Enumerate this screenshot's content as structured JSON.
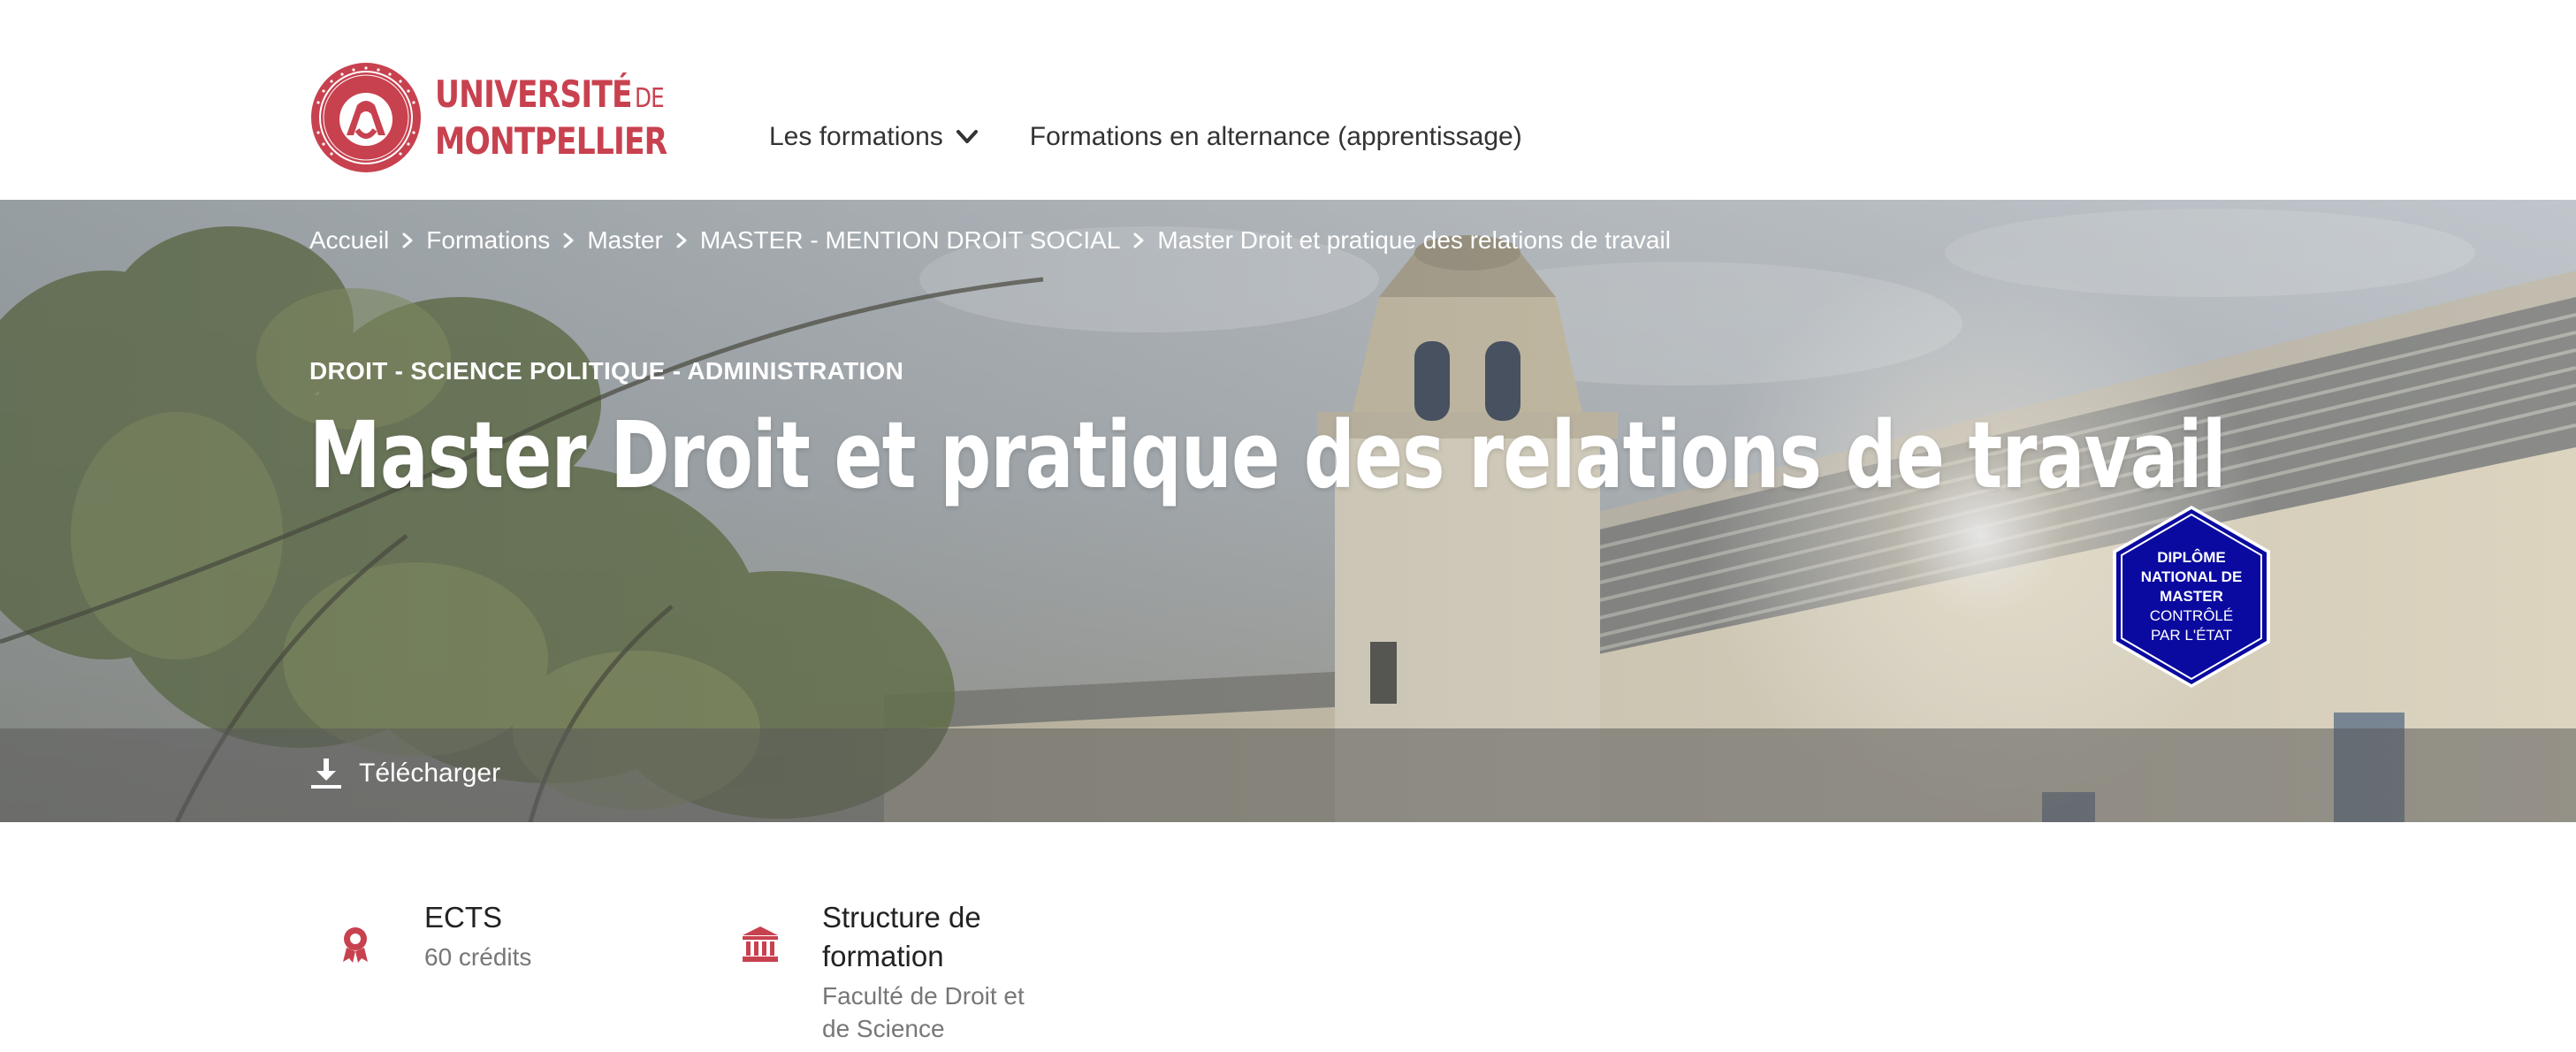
{
  "header": {
    "logo": {
      "line1": "UNIVERSITÉ",
      "line1_suffix": "DE",
      "line2": "MONTPELLIER"
    },
    "nav": [
      {
        "label": "Les formations",
        "has_dropdown": true
      },
      {
        "label": "Formations en alternance (apprentissage)",
        "has_dropdown": false
      }
    ]
  },
  "hero": {
    "breadcrumb": [
      "Accueil",
      "Formations",
      "Master",
      "MASTER - MENTION DROIT SOCIAL",
      "Master Droit et pratique des relations de travail"
    ],
    "category": "DROIT - SCIENCE POLITIQUE - ADMINISTRATION",
    "title": "Master Droit et pratique des relations de travail",
    "badge": {
      "line1": "DIPLÔME",
      "line2": "NATIONAL DE",
      "line3": "MASTER",
      "line4": "CONTRÔLÉ",
      "line5": "PAR L'ÉTAT"
    },
    "download_label": "Télécharger"
  },
  "info": [
    {
      "icon": "award-icon",
      "label": "ECTS",
      "value": "60 crédits"
    },
    {
      "icon": "institution-icon",
      "label_line1": "Structure de",
      "label_line2": "formation",
      "value_line1": "Faculté de Droit et",
      "value_line2": "de Science"
    }
  ],
  "colors": {
    "brand_red": "#c8414f",
    "badge_blue": "#0a0aa0",
    "nav_text": "#333333"
  }
}
